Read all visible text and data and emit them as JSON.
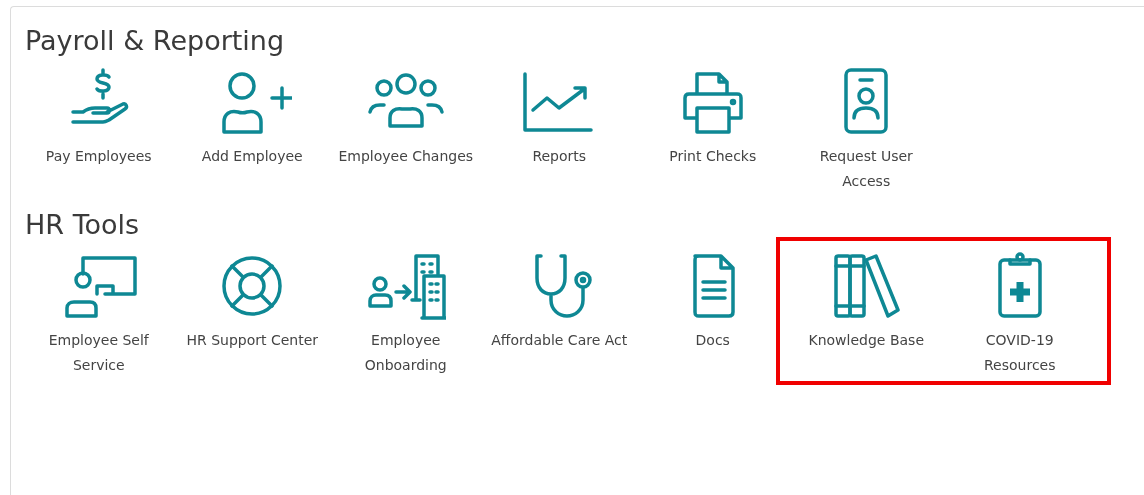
{
  "sections": [
    {
      "title": "Payroll & Reporting",
      "items": [
        {
          "label": "Pay Employees",
          "highlighted": false
        },
        {
          "label": "Add Employee",
          "highlighted": false
        },
        {
          "label": "Employee Changes",
          "highlighted": false
        },
        {
          "label": "Reports",
          "highlighted": false
        },
        {
          "label": "Print Checks",
          "highlighted": false
        },
        {
          "label": "Request User Access",
          "highlighted": false
        }
      ]
    },
    {
      "title": "HR Tools",
      "items": [
        {
          "label": "Employee Self Service",
          "highlighted": false
        },
        {
          "label": "HR Support Center",
          "highlighted": false
        },
        {
          "label": "Employee Onboarding",
          "highlighted": false
        },
        {
          "label": "Affordable Care Act",
          "highlighted": false
        },
        {
          "label": "Docs",
          "highlighted": false
        },
        {
          "label": "Knowledge Base",
          "highlighted": true
        },
        {
          "label": "COVID-19 Resources",
          "highlighted": true
        }
      ]
    }
  ]
}
